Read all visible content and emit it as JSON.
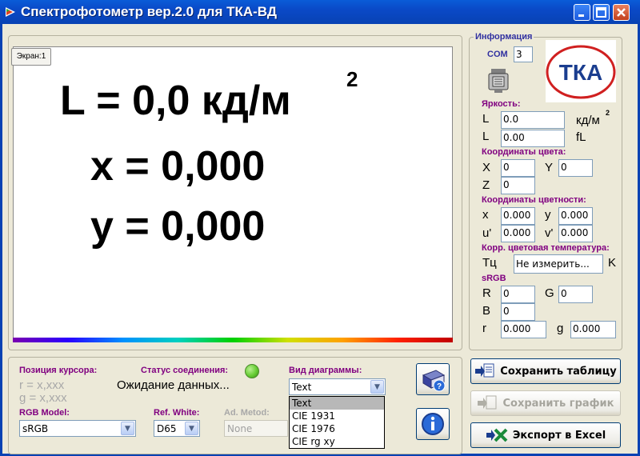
{
  "window": {
    "title": "Спектрофотометр вер.2.0 для ТКА-ВД"
  },
  "display": {
    "screen_tab": "Экран:1",
    "luminance_line": "L = 0,0 кд/м",
    "luminance_sup": "2",
    "x_line": "x = 0,000",
    "y_line": "y = 0,000"
  },
  "info": {
    "title": "Информация",
    "com_label": "COM",
    "com_value": "3",
    "logo_text": "ТКА",
    "brightness_header": "Яркость:",
    "l_label": "L",
    "l_cd_value": "0.0",
    "l_cd_unit": "кд/м",
    "l_cd_unit_sup": "2",
    "l_fl_value": "0.00",
    "l_fl_unit": "fL",
    "color_coords_header": "Координаты цвета:",
    "X_label": "X",
    "X_value": "0",
    "Y_label": "Y",
    "Y_value": "0",
    "Z_label": "Z",
    "Z_value": "0",
    "chroma_header": "Координаты цветности:",
    "x_label": "x",
    "x_value": "0.000",
    "y_label": "y",
    "y_value": "0.000",
    "u_label": "u'",
    "u_value": "0.000",
    "v_label": "v'",
    "v_value": "0.000",
    "cct_header": "Корр. цветовая температура:",
    "tc_label": "Тц",
    "tc_value": "Не измерить...",
    "tc_unit": "K",
    "srgb_header": "sRGB",
    "R_label": "R",
    "R_value": "0",
    "G_label": "G",
    "G_value": "0",
    "B_label": "B",
    "B_value": "0",
    "r_label": "r",
    "r_value": "0.000",
    "g_label": "g",
    "g_value": "0.000"
  },
  "bottom": {
    "cursor_header": "Позиция курсора:",
    "cursor_r": "r = x,xxx",
    "cursor_g": "g = x,xxx",
    "status_header": "Статус соединения:",
    "status_text": "Ожидание данных...",
    "status_color": "#66cc33",
    "diagram_header": "Вид диаграммы:",
    "diagram_selected": "Text",
    "diagram_options": [
      "Text",
      "CIE 1931",
      "CIE 1976",
      "CIE rg xy"
    ],
    "rgb_model_header": "RGB Model:",
    "rgb_model_value": "sRGB",
    "ref_white_header": "Ref. White:",
    "ref_white_value": "D65",
    "ad_method_header": "Ad. Metod:",
    "ad_method_value": "None"
  },
  "buttons": {
    "save_table": "Сохранить таблицу",
    "save_chart": "Сохранить график",
    "export_excel": "Экспорт в Excel"
  }
}
